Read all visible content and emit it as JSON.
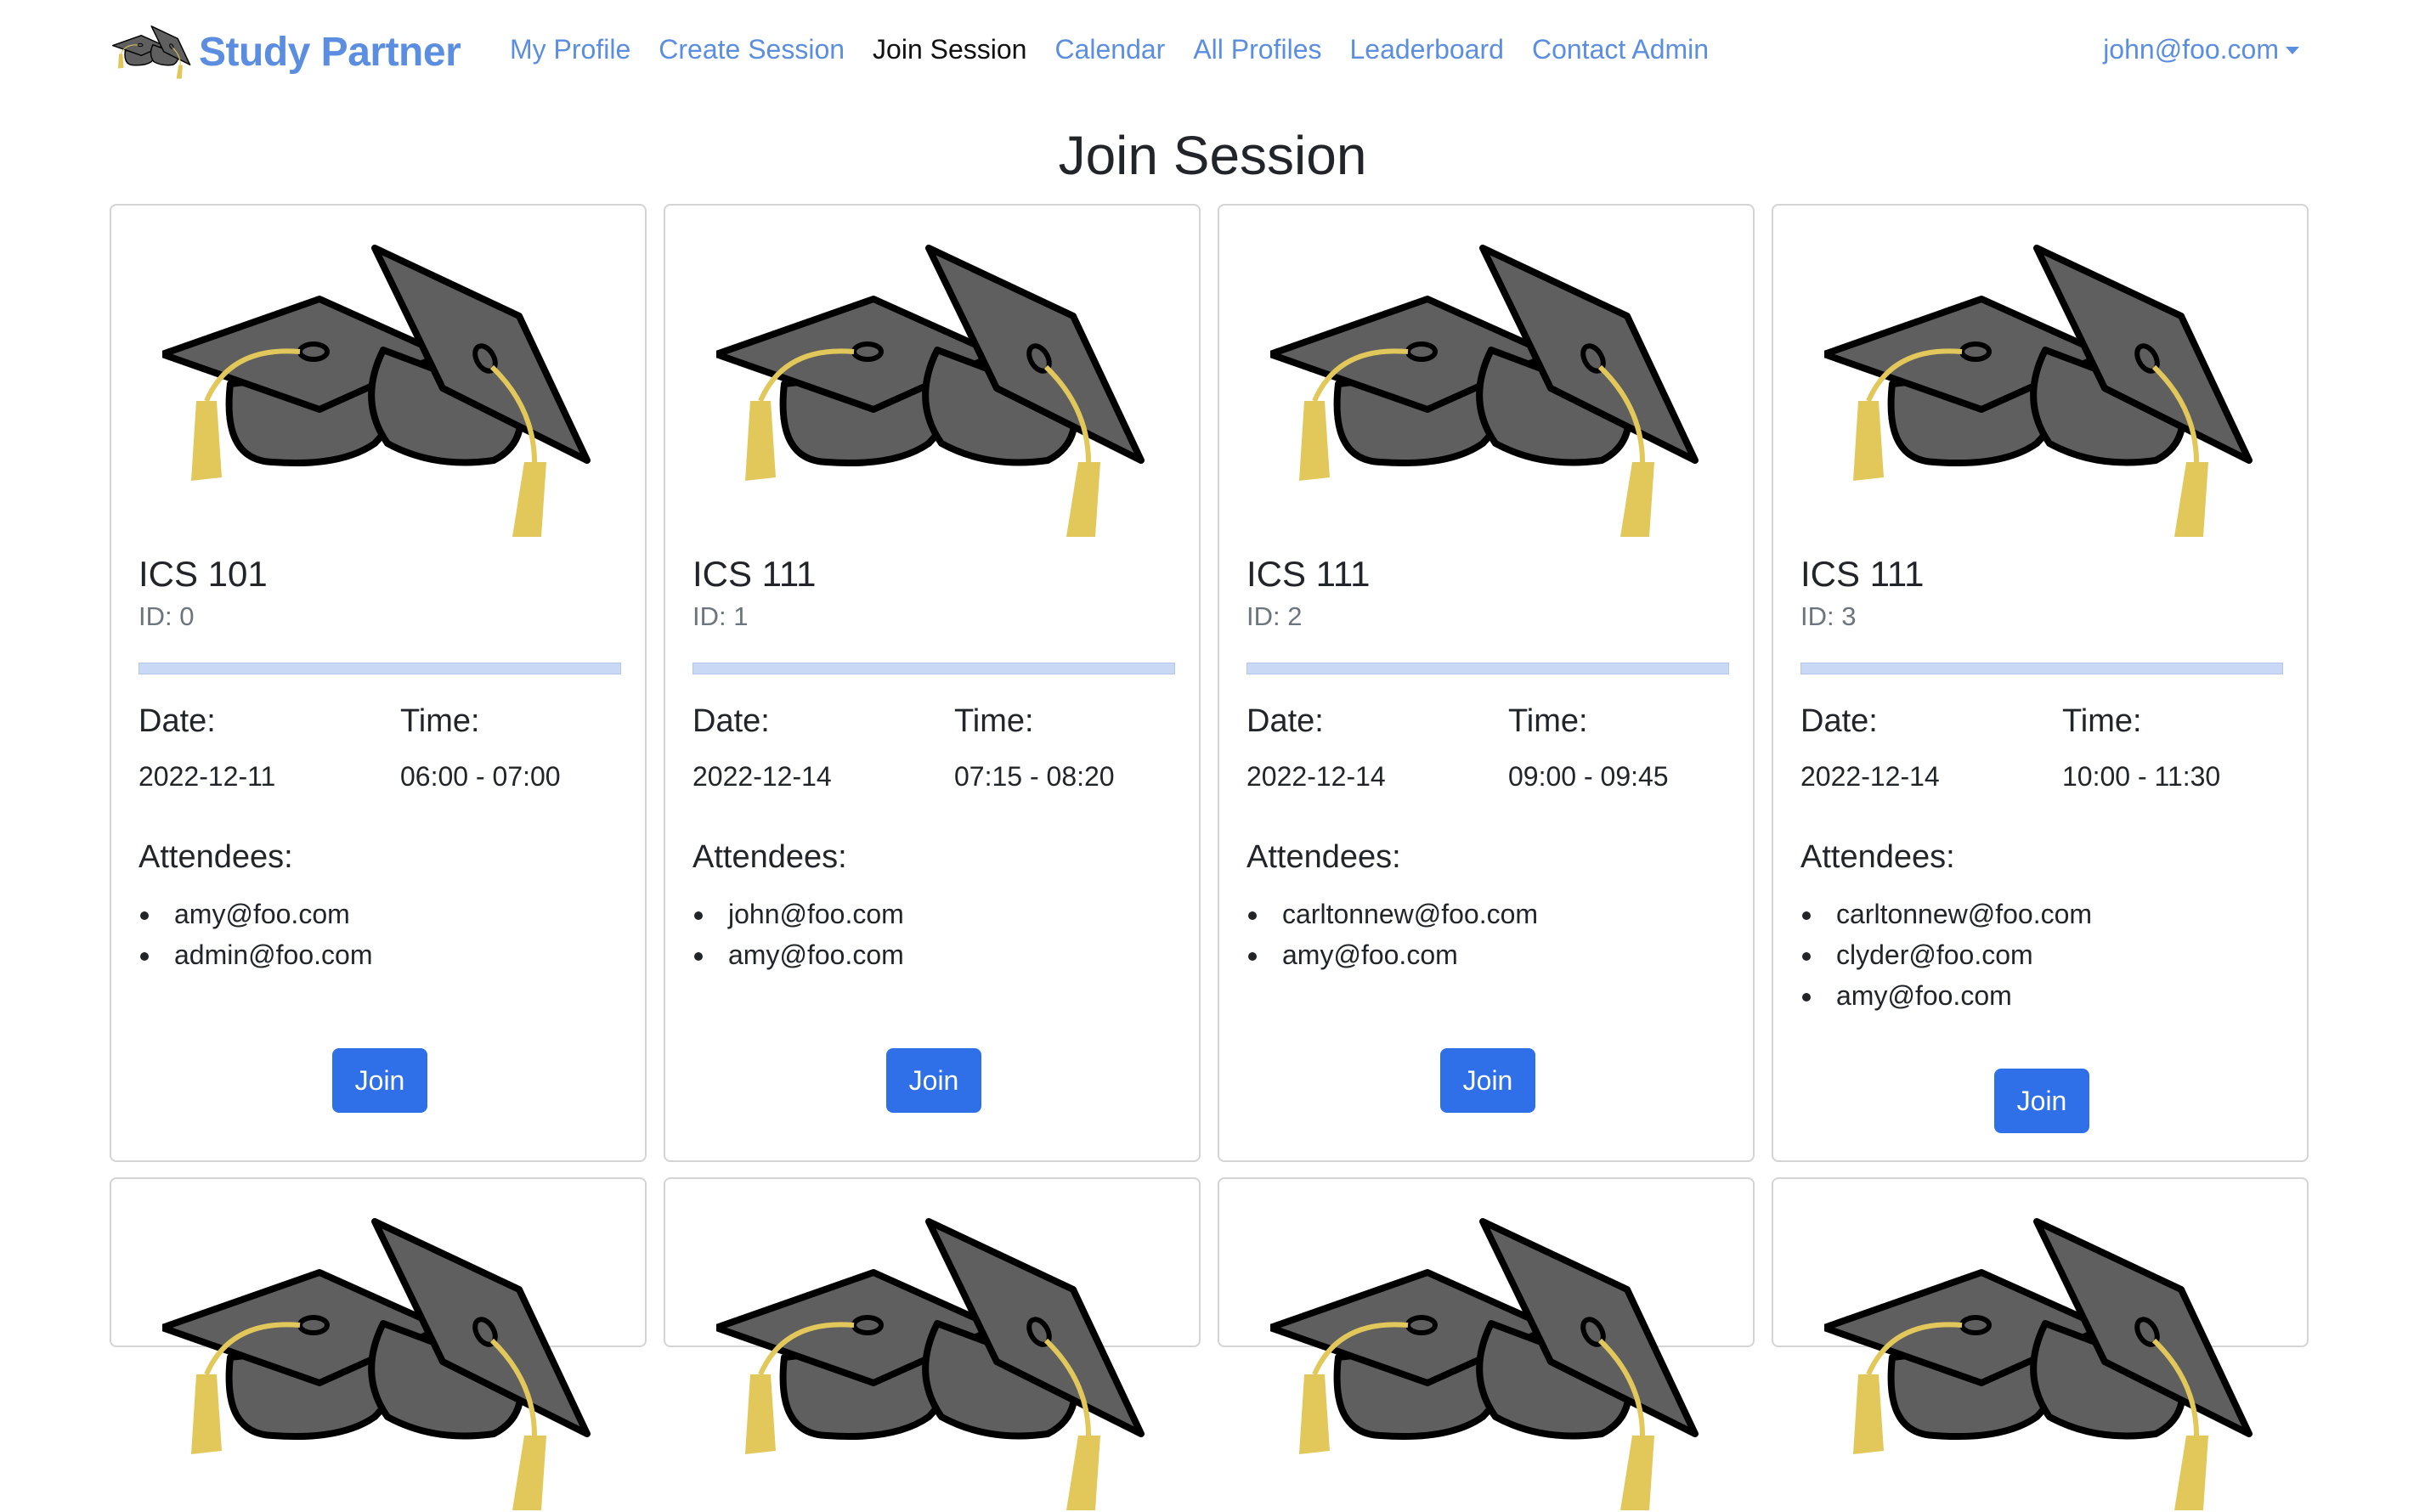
{
  "brand": {
    "name": "Study Partner",
    "logo_icon": "graduation-caps-icon"
  },
  "nav": {
    "links": [
      "My Profile",
      "Create Session",
      "Join Session",
      "Calendar",
      "All Profiles",
      "Leaderboard",
      "Contact Admin"
    ],
    "active": "Join Session",
    "user": "john@foo.com"
  },
  "page": {
    "title": "Join Session"
  },
  "labels": {
    "date": "Date:",
    "time": "Time:",
    "attendees": "Attendees:",
    "join": "Join"
  },
  "sessions": [
    {
      "course": "ICS 101",
      "id": "ID: 0",
      "date": "2022-12-11",
      "time": "06:00 - 07:00",
      "attendees": [
        "amy@foo.com",
        "admin@foo.com"
      ]
    },
    {
      "course": "ICS 111",
      "id": "ID: 1",
      "date": "2022-12-14",
      "time": "07:15 - 08:20",
      "attendees": [
        "john@foo.com",
        "amy@foo.com"
      ]
    },
    {
      "course": "ICS 111",
      "id": "ID: 2",
      "date": "2022-12-14",
      "time": "09:00 - 09:45",
      "attendees": [
        "carltonnew@foo.com",
        "amy@foo.com"
      ]
    },
    {
      "course": "ICS 111",
      "id": "ID: 3",
      "date": "2022-12-14",
      "time": "10:00 - 11:30",
      "attendees": [
        "carltonnew@foo.com",
        "clyder@foo.com",
        "amy@foo.com"
      ]
    }
  ],
  "colors": {
    "accent": "#5b8ee0",
    "button": "#2f6fe8",
    "rule": "#c9d8f4",
    "cap": "#5f5f5f",
    "tassel": "#e2c85a"
  }
}
